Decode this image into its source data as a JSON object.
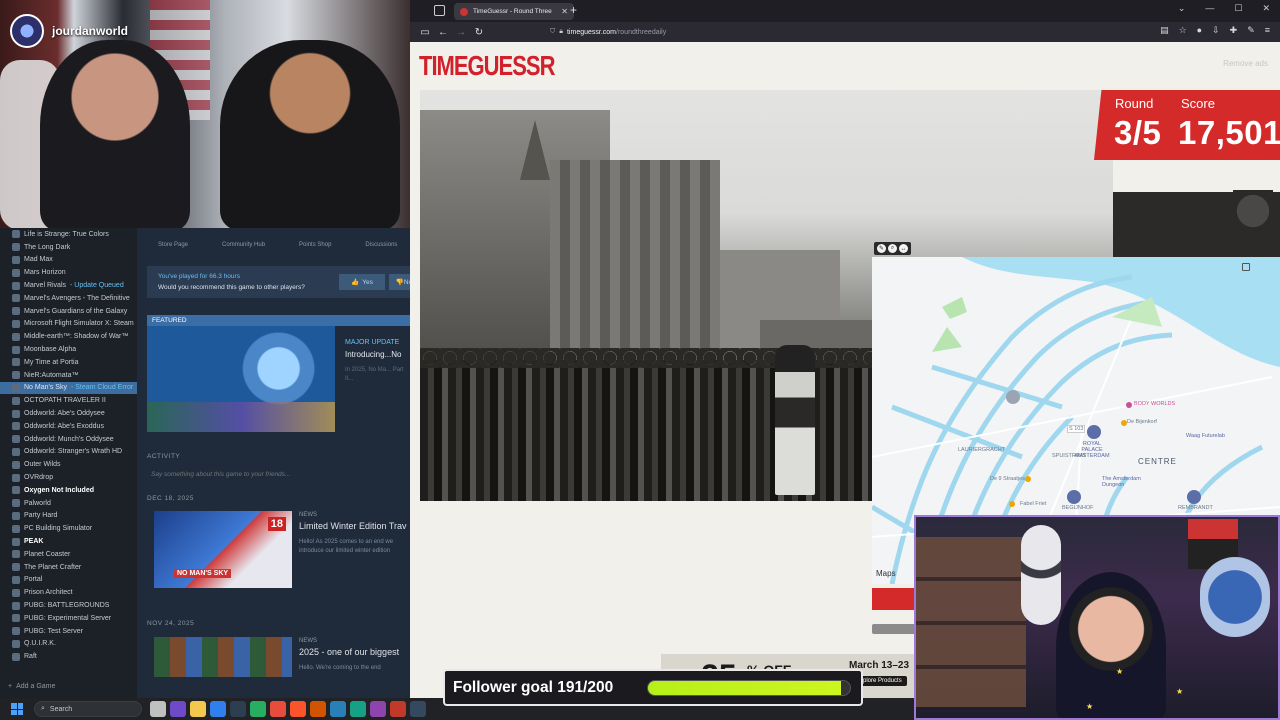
{
  "streamer": {
    "name": "jourdanworld"
  },
  "steam": {
    "library": [
      {
        "label": "Life is Strange: True Colors"
      },
      {
        "label": "The Long Dark"
      },
      {
        "label": "Mad Max"
      },
      {
        "label": "Mars Horizon"
      },
      {
        "label": "Marvel Rivals",
        "status": " - Update Queued"
      },
      {
        "label": "Marvel's Avengers - The Definitive"
      },
      {
        "label": "Marvel's Guardians of the Galaxy"
      },
      {
        "label": "Microsoft Flight Simulator X: Steam"
      },
      {
        "label": "Middle-earth™: Shadow of War™"
      },
      {
        "label": "Moonbase Alpha"
      },
      {
        "label": "My Time at Portia"
      },
      {
        "label": "NieR:Automata™"
      },
      {
        "label": "No Man's Sky",
        "status": " - Steam Cloud Error",
        "active": true
      },
      {
        "label": "OCTOPATH TRAVELER II"
      },
      {
        "label": "Oddworld: Abe's Oddysee"
      },
      {
        "label": "Oddworld: Abe's Exoddus"
      },
      {
        "label": "Oddworld: Munch's Oddysee"
      },
      {
        "label": "Oddworld: Stranger's Wrath HD"
      },
      {
        "label": "Outer Wilds"
      },
      {
        "label": "OVRdrop"
      },
      {
        "label": "Oxygen Not Included",
        "white": true
      },
      {
        "label": "Palworld"
      },
      {
        "label": "Party Hard"
      },
      {
        "label": "PC Building Simulator"
      },
      {
        "label": "PEAK",
        "white": true
      },
      {
        "label": "Planet Coaster"
      },
      {
        "label": "The Planet Crafter"
      },
      {
        "label": "Portal"
      },
      {
        "label": "Prison Architect"
      },
      {
        "label": "PUBG: BATTLEGROUNDS"
      },
      {
        "label": "PUBG: Experimental Server"
      },
      {
        "label": "PUBG: Test Server"
      },
      {
        "label": "Q.U.I.R.K."
      },
      {
        "label": "Raft"
      }
    ],
    "add_game": "Add a Game",
    "tabs": [
      "Store Page",
      "Community Hub",
      "Points Shop",
      "Discussions"
    ],
    "recommend": {
      "played": "You've played for 66.3 hours",
      "question": "Would you recommend this game to other players?",
      "yes": "Yes",
      "no": "No"
    },
    "featured": {
      "header": "FEATURED",
      "tag": "MAJOR UPDATE",
      "title": "Introducing...No",
      "desc": "In 2025, No Ma... Part II..."
    },
    "activity": {
      "header": "ACTIVITY",
      "placeholder": "Say something about this game to your friends..."
    },
    "news": [
      {
        "date": "DEC 18, 2025",
        "label": "NEWS",
        "title": "Limited Winter Edition Trav",
        "body1": "Hello! As 2025 comes to an end we",
        "body2": "introduce our limited winter edition",
        "badge": "NO MAN'S SKY",
        "day": "18"
      },
      {
        "date": "NOV 24, 2025",
        "label": "NEWS",
        "title": "2025 - one of our biggest",
        "body1": "Hello. We're coming to the end"
      }
    ]
  },
  "taskbar": {
    "search": "Search"
  },
  "browser": {
    "tab_title": "TimeGuessr - Round Three",
    "url_domain": "timeguessr.com",
    "url_path": "/roundthreedaily"
  },
  "timeguessr": {
    "logo": "TIMEGUESSR",
    "remove_ads": "Remove ads",
    "round_label": "Round",
    "score_label": "Score",
    "round_value": "3/5",
    "score_value": "17,501",
    "maps_label": "Maps",
    "map_labels": {
      "centre": "CENTRE",
      "body_worlds": "BODY WORLDS",
      "royal_palace": "ROYAL PALACE AMSTERDAM",
      "de_bijenkorf": "De Bijenkorf",
      "waag": "Waag Futurelab",
      "negen_straatjes": "De 9 Straatjes",
      "fabel_friet": "Fabel Friet",
      "amsterdam_dungeon": "The Amsterdam Dungeon",
      "begijnhof": "BEGIJNHOF",
      "rembrandt": "REMBRANDT",
      "lauriergracht": "LAURIERGRACHT",
      "spuistraat": "SPUISTRAAT",
      "s103": "S 103"
    },
    "ad": {
      "percent": "25",
      "off": "% OFF",
      "dates": "March 13–23",
      "button": "Explore Products"
    }
  },
  "follower_goal": {
    "text": "Follower goal 191/200",
    "current": 191,
    "target": 200
  },
  "colors": {
    "brand_red": "#d52a2a",
    "steam_blue": "#66c0f4",
    "goal_green": "#c4f01e"
  }
}
